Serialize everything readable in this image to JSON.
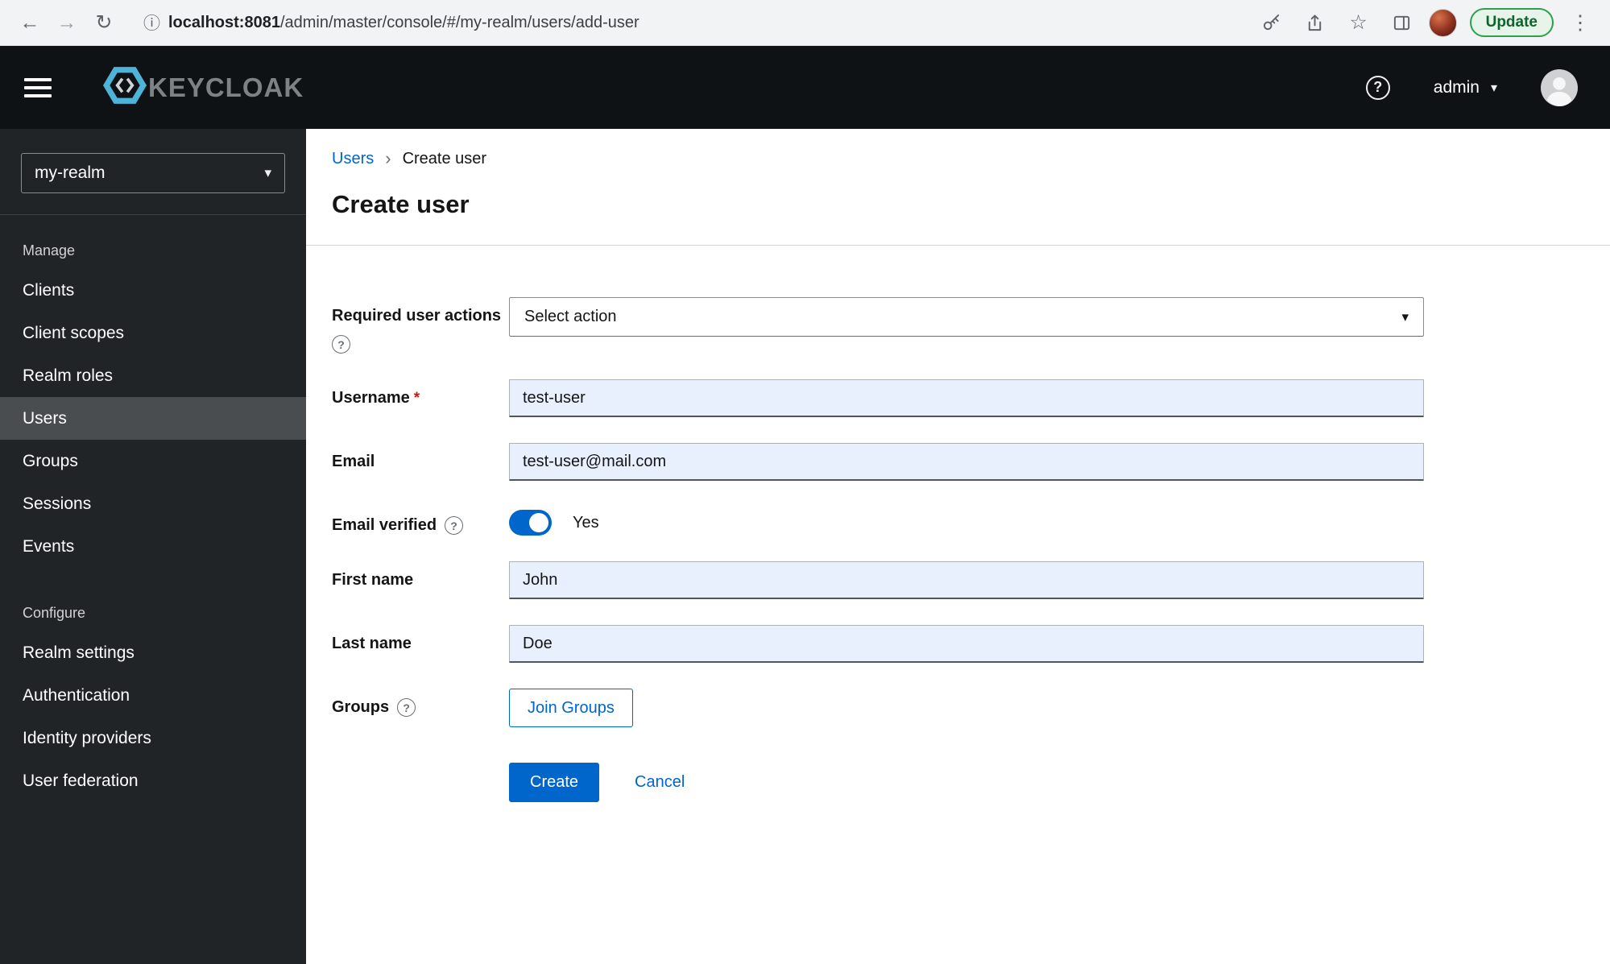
{
  "browser": {
    "url_host": "localhost:8081",
    "url_path": "/admin/master/console/#/my-realm/users/add-user",
    "update_label": "Update"
  },
  "header": {
    "brand": "KEYCLOAK",
    "username": "admin"
  },
  "sidebar": {
    "realm": "my-realm",
    "sections": [
      {
        "label": "Manage",
        "items": [
          {
            "label": "Clients"
          },
          {
            "label": "Client scopes"
          },
          {
            "label": "Realm roles"
          },
          {
            "label": "Users"
          },
          {
            "label": "Groups"
          },
          {
            "label": "Sessions"
          },
          {
            "label": "Events"
          }
        ]
      },
      {
        "label": "Configure",
        "items": [
          {
            "label": "Realm settings"
          },
          {
            "label": "Authentication"
          },
          {
            "label": "Identity providers"
          },
          {
            "label": "User federation"
          }
        ]
      }
    ]
  },
  "main": {
    "breadcrumb": {
      "parent": "Users",
      "current": "Create user"
    },
    "title": "Create user",
    "form": {
      "required_actions": {
        "label": "Required user actions",
        "placeholder": "Select action"
      },
      "username": {
        "label": "Username",
        "required_mark": "*",
        "value": "test-user"
      },
      "email": {
        "label": "Email",
        "value": "test-user@mail.com"
      },
      "email_verified": {
        "label": "Email verified",
        "state_label": "Yes"
      },
      "first_name": {
        "label": "First name",
        "value": "John"
      },
      "last_name": {
        "label": "Last name",
        "value": "Doe"
      },
      "groups": {
        "label": "Groups",
        "join_button_label": "Join Groups"
      },
      "create_label": "Create",
      "cancel_label": "Cancel"
    }
  },
  "icons": {
    "back": "←",
    "forward": "→",
    "reload": "↻",
    "info": "ⓘ",
    "star": "☆",
    "menu_dots": "⋮",
    "caret_down": "▾",
    "breadcrumb_sep": "›",
    "help": "?"
  },
  "colors": {
    "accent_blue": "#0066cc",
    "autofill_blue": "#e8f0fe",
    "sidebar_bg": "#212427",
    "header_bg": "#0f1214",
    "update_green": "#0d652d"
  }
}
